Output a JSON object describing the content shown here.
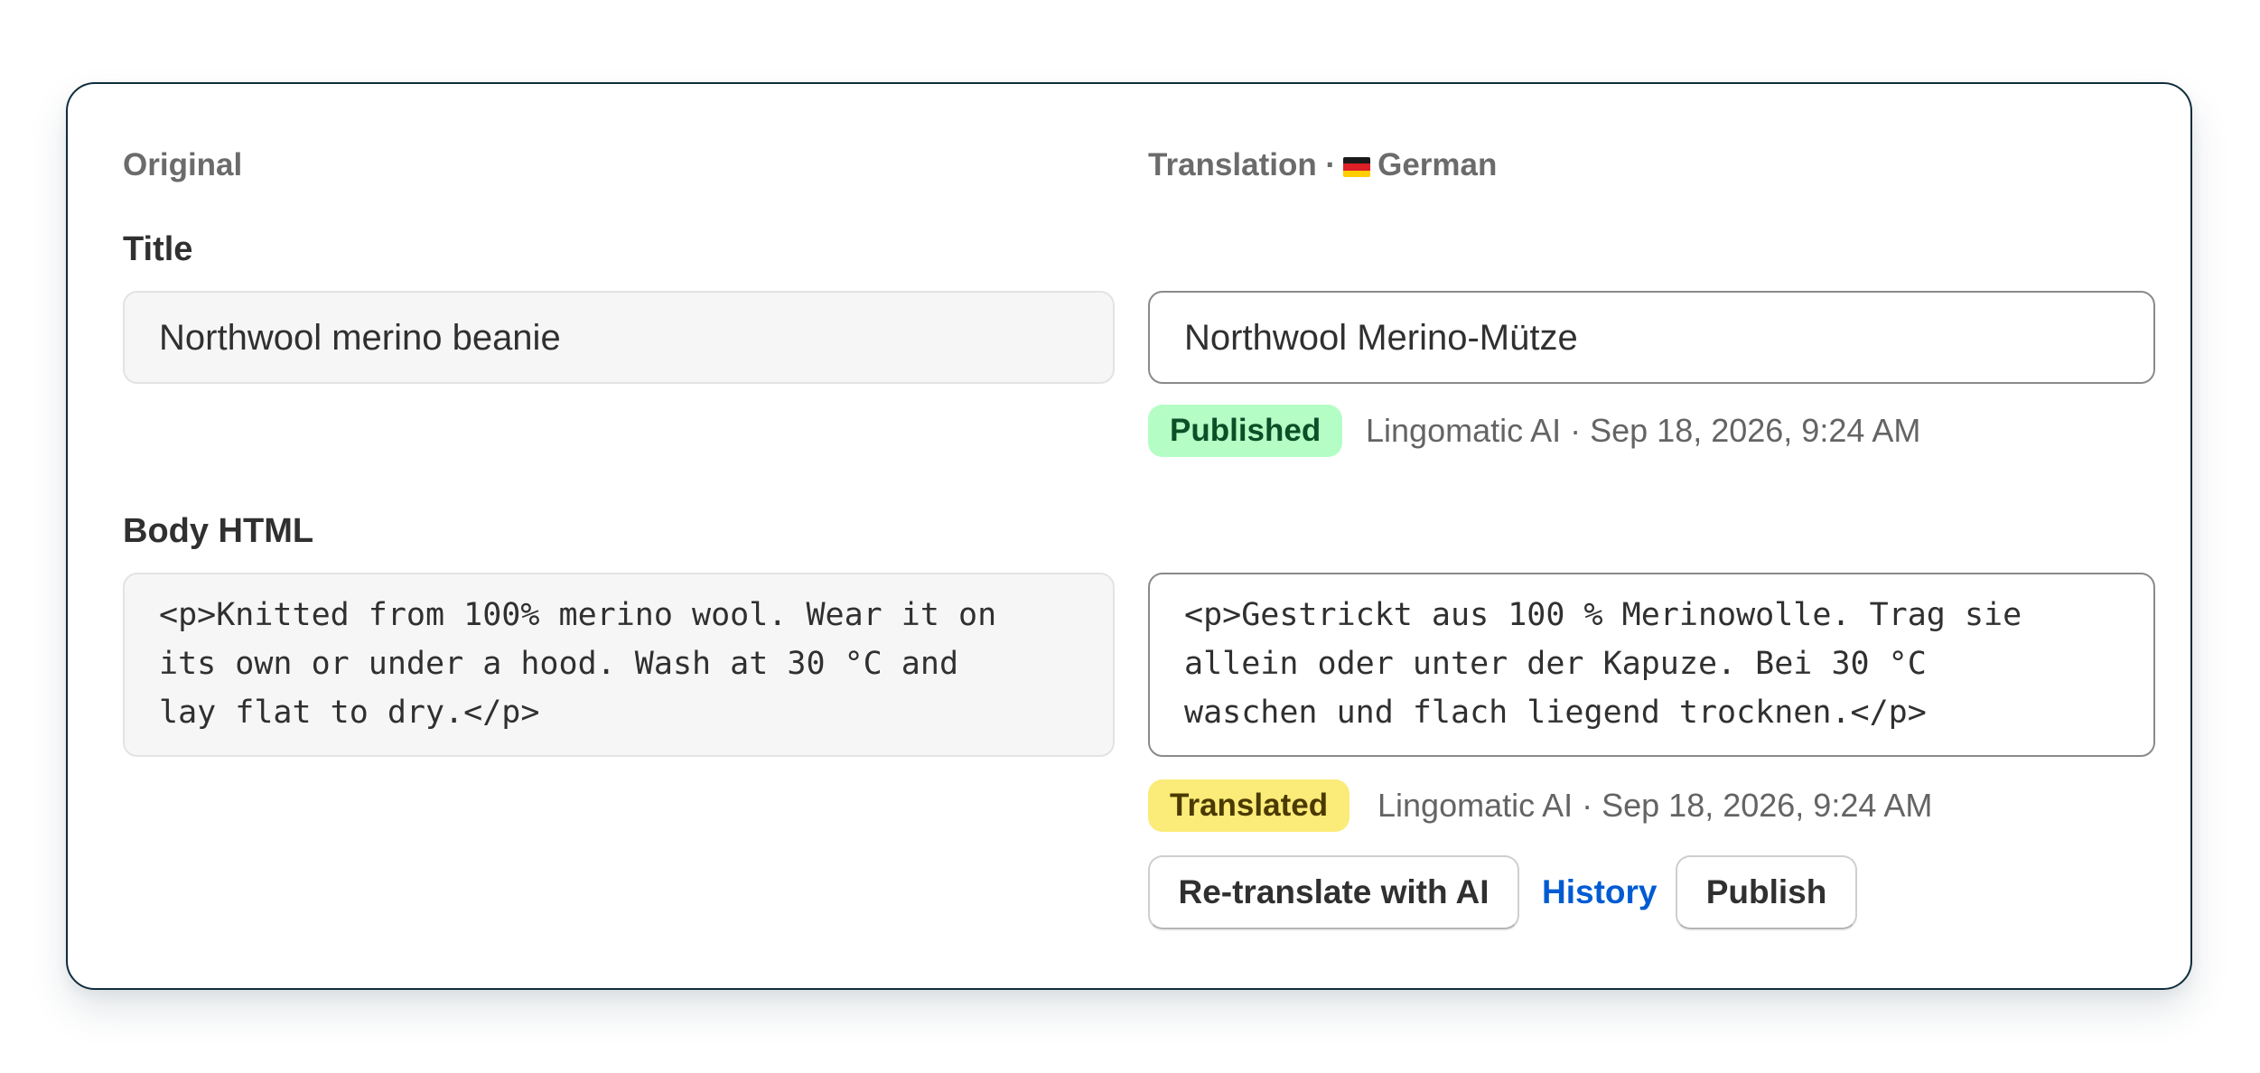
{
  "original": {
    "heading": "Original",
    "title_label": "Title",
    "title_value": "Northwool merino beanie",
    "body_label": "Body HTML",
    "body_lines": [
      "<p>Knitted from 100% merino wool. Wear it on",
      "its own or under a hood. Wash at 30 °C and",
      "lay flat to dry.</p>"
    ]
  },
  "translation": {
    "heading_prefix": "Translation ·",
    "language": "German",
    "flag_icon": "germany-flag-icon",
    "title_value": "Northwool Merino-Mütze",
    "title_status": "Published",
    "title_meta": "Lingomatic AI · Sep 18, 2026, 9:24 AM",
    "body_lines": [
      "<p>Gestrickt aus 100 % Merinowolle. Trag sie",
      "allein oder unter der Kapuze. Bei 30 °C",
      "waschen und flach liegend trocknen.</p>"
    ],
    "body_status": "Translated",
    "body_meta": "Lingomatic AI · Sep 18, 2026, 9:24 AM"
  },
  "actions": {
    "retranslate_label": "Re-translate with AI",
    "history_label": "History",
    "publish_label": "Publish"
  },
  "colors": {
    "card_border": "#0f2d3c",
    "published_badge": "#b4fec6",
    "translated_badge": "#fbeb78",
    "link": "#005bd3"
  }
}
